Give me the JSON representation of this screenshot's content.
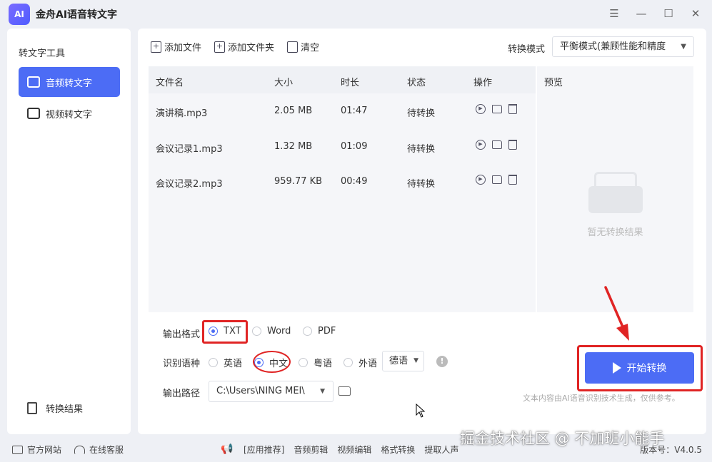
{
  "app": {
    "logo_text": "AI",
    "title": "金舟AI语音转文字"
  },
  "window_controls": {
    "menu": "☰",
    "minimize": "—",
    "maximize": "☐",
    "close": "✕"
  },
  "sidebar": {
    "title": "转文字工具",
    "items": [
      {
        "label": "音频转文字",
        "active": true
      },
      {
        "label": "视频转文字",
        "active": false
      }
    ],
    "result_label": "转换结果"
  },
  "toolbar": {
    "add_file": "添加文件",
    "add_folder": "添加文件夹",
    "clear": "清空",
    "mode_label": "转换模式",
    "mode_value": "平衡模式(兼顾性能和精度"
  },
  "table": {
    "headers": [
      "文件名",
      "大小",
      "时长",
      "状态",
      "操作"
    ],
    "rows": [
      {
        "name": "演讲稿.mp3",
        "size": "2.05 MB",
        "duration": "01:47",
        "status": "待转换"
      },
      {
        "name": "会议记录1.mp3",
        "size": "1.32 MB",
        "duration": "01:09",
        "status": "待转换"
      },
      {
        "name": "会议记录2.mp3",
        "size": "959.77 KB",
        "duration": "00:49",
        "status": "待转换"
      }
    ]
  },
  "preview": {
    "title": "预览",
    "empty_text": "暂无转换结果"
  },
  "options": {
    "format_label": "输出格式",
    "formats": [
      "TXT",
      "Word",
      "PDF"
    ],
    "selected_format": "TXT",
    "lang_label": "识别语种",
    "langs": [
      "英语",
      "中文",
      "粤语",
      "外语"
    ],
    "selected_lang": "中文",
    "foreign_lang": "德语",
    "path_label": "输出路径",
    "path_value": "C:\\Users\\NING MEI\\"
  },
  "start_button": "开始转换",
  "disclaimer": "文本内容由AI语音识别技术生成，仅供参考。",
  "statusbar": {
    "website": "官方网站",
    "support": "在线客服",
    "links": [
      "[应用推荐]",
      "音频剪辑",
      "视频编辑",
      "格式转换",
      "提取人声"
    ],
    "version": "版本号：V4.0.5"
  },
  "watermark": "掘金技术社区 @ 不加班小能手",
  "colors": {
    "accent": "#4c6cf5",
    "highlight": "#e02424",
    "background": "#eef0f5"
  }
}
